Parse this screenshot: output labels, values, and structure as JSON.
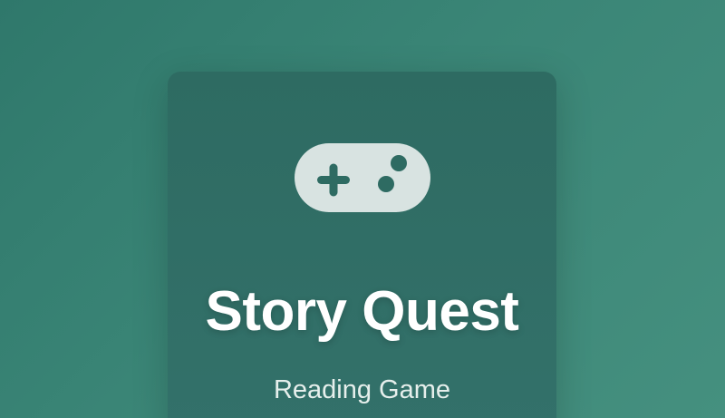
{
  "game": {
    "icon": "gamepad-icon",
    "title": "Story Quest",
    "subtitle": "Reading Game"
  },
  "colors": {
    "background": "#3a8576",
    "card": "#2e6b62",
    "icon_fill": "#d8e3e1",
    "text": "#ffffff"
  }
}
